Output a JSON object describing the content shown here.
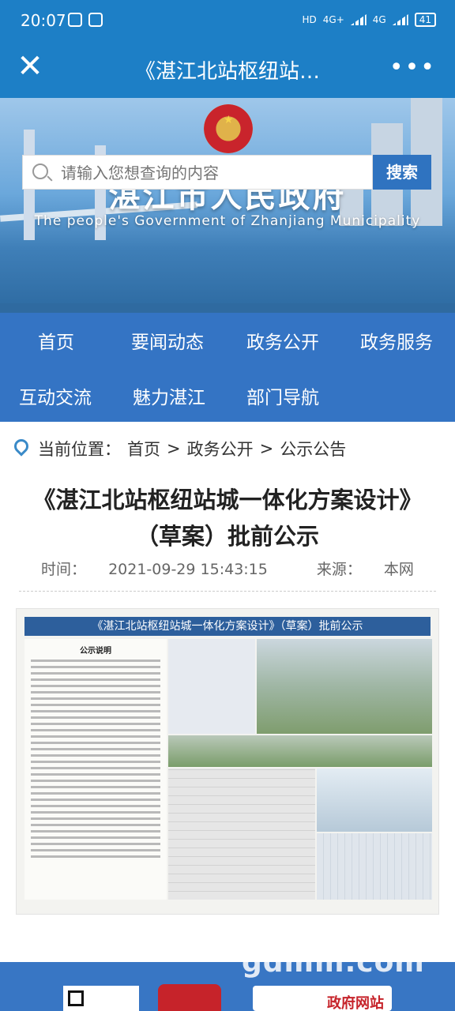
{
  "status_bar": {
    "time": "20:07",
    "network_labels": [
      "HD",
      "4G+",
      "4G"
    ],
    "battery": "41"
  },
  "title_bar": {
    "title": "《湛江北站枢纽站…",
    "close_icon": "close-icon",
    "more_icon": "more-icon"
  },
  "banner": {
    "site_title": "湛江市人民政府",
    "site_subtitle": "The people's Government of Zhanjiang Municipality",
    "search_placeholder": "请输入您想查询的内容",
    "search_button": "搜索"
  },
  "nav": {
    "row1": [
      "首页",
      "要闻动态",
      "政务公开",
      "政务服务"
    ],
    "row2": [
      "互动交流",
      "魅力湛江",
      "部门导航"
    ]
  },
  "breadcrumb": {
    "label": "当前位置：",
    "items": [
      "首页",
      ">",
      "政务公开",
      ">",
      "公示公告"
    ]
  },
  "article": {
    "title_line1": "《湛江北站枢纽站城一体化方案设计》",
    "title_line2": "（草案）批前公示",
    "time_label": "时间：",
    "time": "2021-09-29 15:43:15",
    "source_label": "来源：",
    "source": "本网",
    "poster_title": "《湛江北站枢纽站城一体化方案设计》（草案）批前公示",
    "poster_section": "公示说明"
  },
  "footer": {
    "site_link": "政府网站"
  },
  "watermark": "gdmm.com",
  "colors": {
    "brand_blue": "#1d7fc6",
    "nav_blue": "#3474c4",
    "search_button": "#2f73c0",
    "footer_blue": "#3876c4"
  }
}
